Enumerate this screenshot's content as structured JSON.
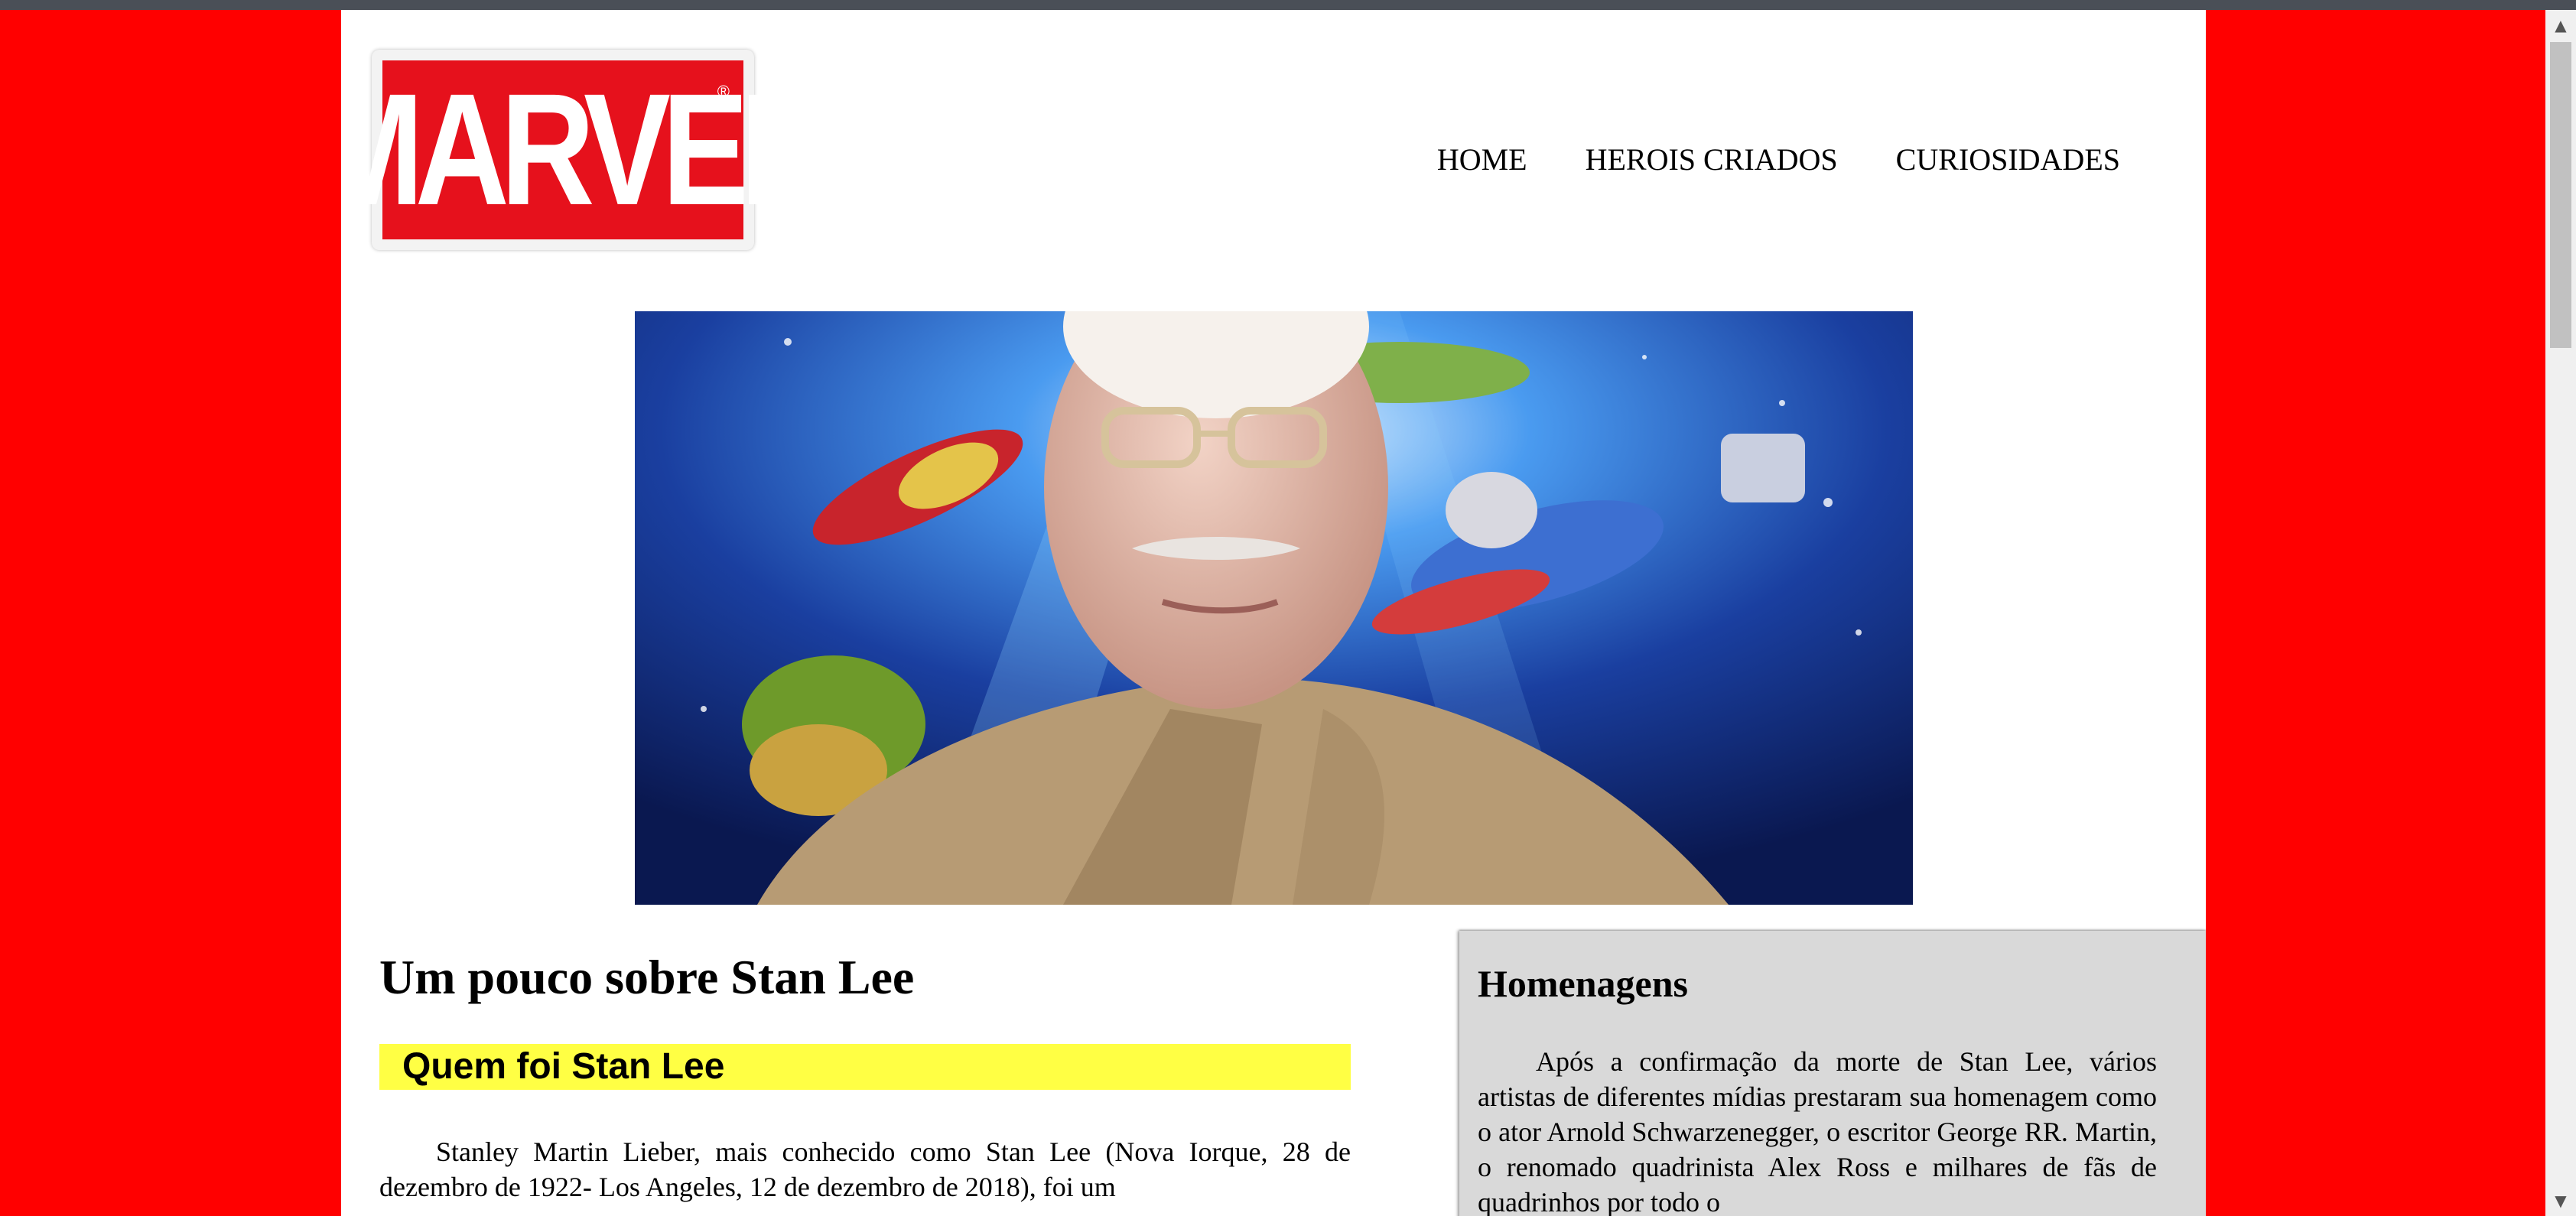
{
  "brand": {
    "logo_text": "MARVEL",
    "registered_mark": "®",
    "accent_color": "#ff0000",
    "logo_color": "#e6111c"
  },
  "nav": {
    "items": [
      {
        "label": "HOME"
      },
      {
        "label": "HEROIS CRIADOS"
      },
      {
        "label": "CURIOSIDADES"
      }
    ]
  },
  "hero": {
    "image_subject": "stan-lee-with-comic-heroes"
  },
  "main": {
    "title": "Um pouco sobre Stan Lee",
    "subheading": "Quem foi Stan Lee",
    "subheading_bg": "#ffff44",
    "body": "Stanley Martin Lieber, mais conhecido como Stan Lee (Nova Iorque, 28 de dezembro de 1922- Los Angeles, 12 de dezembro de 2018), foi um"
  },
  "sidebar": {
    "title": "Homenagens",
    "body": "Após a confirmação da morte de Stan Lee, vários artistas de diferentes mídias prestaram sua homenagem como o ator Arnold Schwarzenegger, o escritor George RR. Martin, o renomado quadrinista Alex Ross e milhares de fãs de quadrinhos por todo o"
  },
  "scrollbar": {
    "up_icon": "▲",
    "down_icon": "▼"
  }
}
